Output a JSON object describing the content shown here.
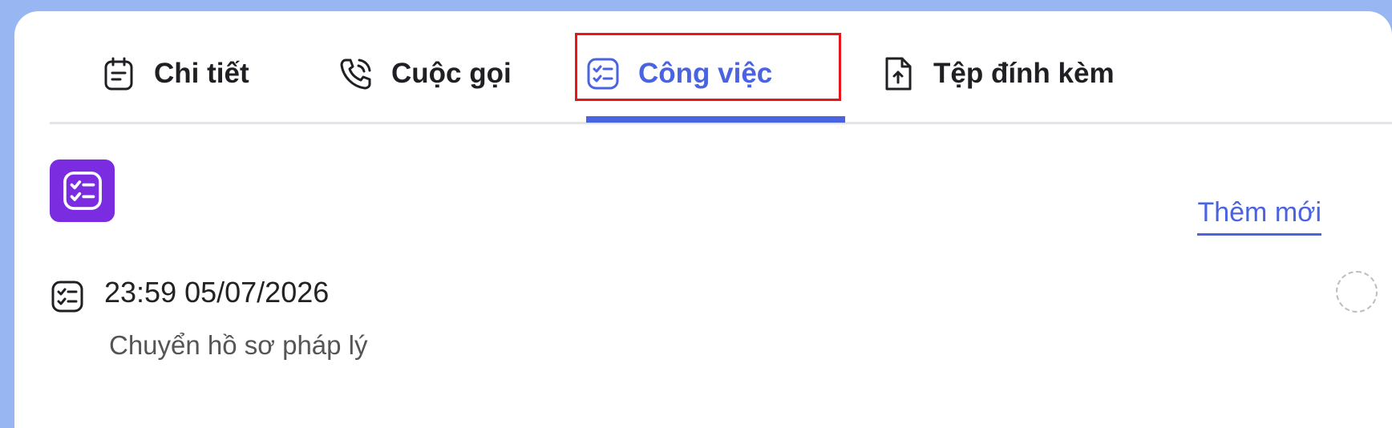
{
  "tabs": [
    {
      "label": "Chi tiết",
      "icon": "clipboard-icon"
    },
    {
      "label": "Cuộc gọi",
      "icon": "phone-call-icon"
    },
    {
      "label": "Công việc",
      "icon": "task-list-icon",
      "active": true
    },
    {
      "label": "Tệp đính kèm",
      "icon": "file-upload-icon"
    }
  ],
  "tasks_panel": {
    "add_new_label": "Thêm mới",
    "items": [
      {
        "time": "23:59 05/07/2026",
        "title": "Chuyển hồ sơ pháp lý"
      }
    ]
  },
  "colors": {
    "accent": "#4a63e0",
    "badge": "#7b2be0",
    "highlight": "#e8161b",
    "background": "#98b6f1"
  }
}
